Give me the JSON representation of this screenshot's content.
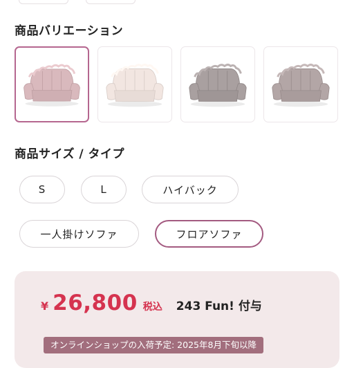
{
  "variation_section": {
    "title": "商品バリエーション",
    "items": [
      {
        "color": "#d9b9bd",
        "selected": true
      },
      {
        "color": "#f2e6e1",
        "selected": false
      },
      {
        "color": "#a9a0a0",
        "selected": false
      },
      {
        "color": "#b3a6a6",
        "selected": false
      }
    ]
  },
  "size_section": {
    "title": "商品サイズ / タイプ",
    "options": [
      {
        "label": "S",
        "selected": false
      },
      {
        "label": "L",
        "selected": false
      },
      {
        "label": "ハイバック",
        "selected": false
      },
      {
        "label": "一人掛けソファ",
        "selected": false
      },
      {
        "label": "フロアソファ",
        "selected": true
      }
    ]
  },
  "price_panel": {
    "yen_symbol": "¥",
    "price": "26,800",
    "tax_label": "税込",
    "points": "243 Fun! 付与",
    "notice": "オンラインショップの入荷予定: 2025年8月下旬以降"
  },
  "colors": {
    "accent": "#b5668f",
    "price": "#d5334f",
    "panel_bg": "#f3e9ea",
    "notice_bg": "#a26e7d"
  }
}
